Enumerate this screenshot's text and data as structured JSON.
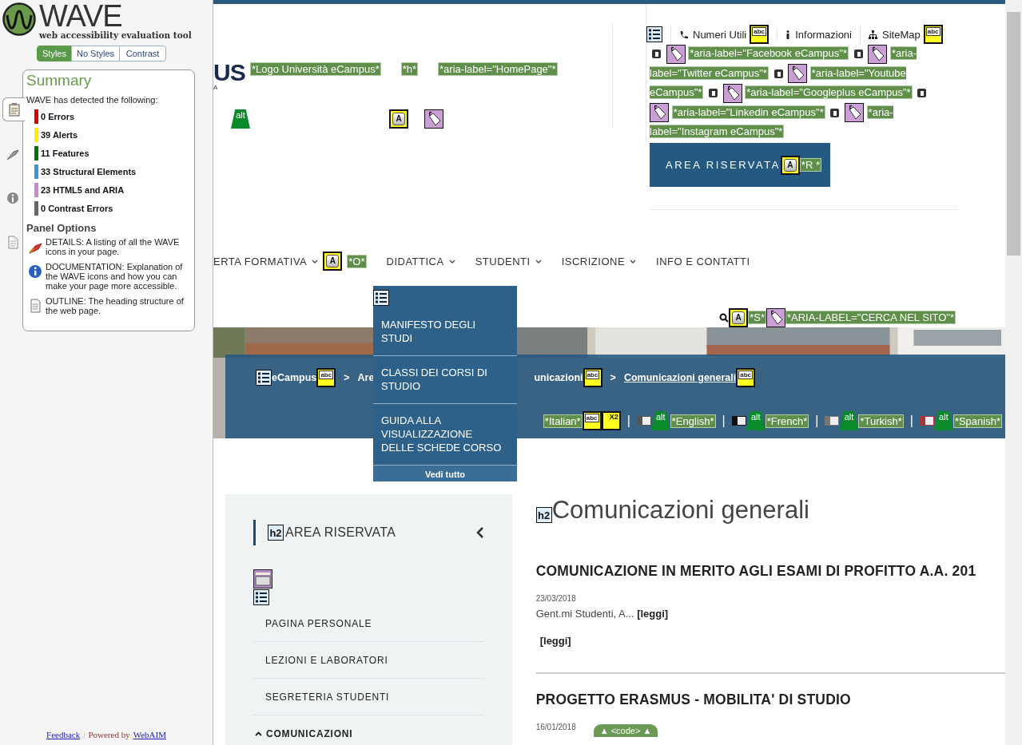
{
  "wave": {
    "logo_title": "WAVE",
    "logo_subtitle": "web accessibility evaluation tool",
    "view_tabs": [
      {
        "label": "Styles",
        "selected": true
      },
      {
        "label": "No Styles",
        "selected": false
      },
      {
        "label": "Contrast",
        "selected": false
      }
    ],
    "side_tabs": [
      {
        "kind": "summary",
        "selected": true
      },
      {
        "kind": "details",
        "selected": false
      },
      {
        "kind": "documentation",
        "selected": false
      },
      {
        "kind": "outline",
        "selected": false
      }
    ],
    "summary": {
      "title": "Summary",
      "intro": "WAVE has detected the following:",
      "items": [
        {
          "label": "0 Errors",
          "color": "#e00000"
        },
        {
          "label": "39 Alerts",
          "color": "#ffee00"
        },
        {
          "label": "11 Features",
          "color": "#007700"
        },
        {
          "label": "33 Structural Elements",
          "color": "#3399dd"
        },
        {
          "label": "23 HTML5 and ARIA",
          "color": "#cc88cc"
        },
        {
          "label": "0 Contrast Errors",
          "color": "#666666"
        }
      ],
      "options_title": "Panel Options",
      "options": [
        {
          "kind": "details",
          "text": "DETAILS: A listing of all the WAVE icons in your page."
        },
        {
          "kind": "documentation",
          "text": "DOCUMENTATION: Explanation of the WAVE icons and how you can make your page more accessible."
        },
        {
          "kind": "outline",
          "text": "OUTLINE: The heading structure of the web page."
        }
      ]
    },
    "footer": {
      "feedback": "Feedback",
      "separator": "|",
      "powered_by": "Powered by",
      "webaim": "WebAIM"
    }
  },
  "page": {
    "logo": {
      "text": "US",
      "tagline": "A"
    },
    "logo_labels": [
      {
        "kind": "label",
        "text": "*Logo Università eCampus*"
      },
      {
        "kind": "label",
        "text": "*h*"
      },
      {
        "kind": "label",
        "text": "*aria-label=\"HomePage\"*"
      }
    ],
    "logo_icons": [
      {
        "kind": "alt",
        "label": "alt"
      },
      {
        "kind": "accesskey",
        "label": "A"
      },
      {
        "kind": "tag"
      }
    ],
    "utility": [
      [
        {
          "kind": "list"
        }
      ],
      [
        {
          "kind": "phone"
        },
        {
          "kind": "text",
          "text": "Numeri Utili"
        },
        {
          "kind": "abc",
          "label": "abc"
        }
      ],
      [
        {
          "kind": "info"
        },
        {
          "kind": "text",
          "text": "Informazioni"
        }
      ],
      [
        {
          "kind": "sitemap"
        },
        {
          "kind": "text",
          "text": "SiteMap"
        },
        {
          "kind": "abc",
          "label": "abc"
        }
      ]
    ],
    "social": [
      {
        "kind": "social"
      },
      {
        "kind": "tag"
      },
      {
        "kind": "label",
        "text": "*aria-label=\"Facebook eCampus\"*"
      },
      {
        "kind": "social"
      },
      {
        "kind": "tag"
      },
      {
        "kind": "label",
        "text": "*aria-label=\"Twitter eCampus\"*"
      },
      {
        "kind": "social"
      },
      {
        "kind": "tag"
      },
      {
        "kind": "label",
        "text": "*aria-label=\"Youtube eCampus\"*"
      },
      {
        "kind": "social"
      },
      {
        "kind": "tag"
      },
      {
        "kind": "label",
        "text": "*aria-label=\"Googleplus eCampus\"*"
      },
      {
        "kind": "social"
      },
      {
        "kind": "tag"
      },
      {
        "kind": "label",
        "text": "*aria-label=\"Linkedin eCampus\"*"
      },
      {
        "kind": "social"
      },
      {
        "kind": "tag"
      },
      {
        "kind": "label",
        "text": "*aria-label=\"Instagram eCampus\"*"
      }
    ],
    "reserved_button": {
      "label": "AREA RISERVATA",
      "marks": [
        {
          "kind": "accesskey",
          "label": "A"
        },
        {
          "kind": "label",
          "text": "*R *"
        }
      ]
    },
    "nav": [
      {
        "label": "ERTA FORMATIVA",
        "dropdown": true,
        "marks": [
          {
            "kind": "accesskey",
            "label": "A"
          },
          {
            "kind": "label",
            "text": "*O*"
          }
        ]
      },
      {
        "label": "DIDATTICA",
        "dropdown": true
      },
      {
        "label": "STUDENTI",
        "dropdown": true
      },
      {
        "label": "ISCRIZIONE",
        "dropdown": true
      },
      {
        "label": "INFO E CONTATTI",
        "dropdown": false
      }
    ],
    "search": [
      {
        "kind": "search"
      },
      {
        "kind": "accesskey",
        "label": "A"
      },
      {
        "kind": "label",
        "text": "*S*"
      },
      {
        "kind": "tag"
      },
      {
        "kind": "label",
        "text": "*ARIA-LABEL=\"CERCA NEL SITO\"*"
      }
    ],
    "dropdown_menu": {
      "items": [
        "MANIFESTO DEGLI STUDI",
        "CLASSI DEI CORSI DI STUDIO",
        "GUIDA ALLA VISUALIZZAZIONE DELLE SCHEDE CORSO"
      ],
      "footer": "Vedi tutto"
    },
    "breadcrumb_start": [
      {
        "kind": "list"
      },
      {
        "kind": "text",
        "text": "eCampus"
      },
      {
        "kind": "abc",
        "label": "abc"
      },
      {
        "kind": "crumbsep",
        "text": ">"
      },
      {
        "kind": "text",
        "text": "Are"
      }
    ],
    "breadcrumb_end": [
      {
        "kind": "text",
        "text": "unicazioni"
      },
      {
        "kind": "abc",
        "label": "abc"
      },
      {
        "kind": "crumbsep",
        "text": ">"
      },
      {
        "kind": "link",
        "text": "Comunicazioni generali"
      },
      {
        "kind": "abc",
        "label": "abc"
      }
    ],
    "languages": [
      {
        "kind": "label",
        "text": "*Italian*"
      },
      {
        "kind": "abc",
        "label": "abc"
      },
      {
        "kind": "x2",
        "label": "X2"
      },
      {
        "kind": "crumbsep",
        "text": "|"
      },
      {
        "kind": "flag",
        "color": "#555555"
      },
      {
        "kind": "alt",
        "label": "alt"
      },
      {
        "kind": "label",
        "text": "*English*"
      },
      {
        "kind": "crumbsep",
        "text": "|"
      },
      {
        "kind": "flag",
        "color": "#111111"
      },
      {
        "kind": "alt",
        "label": "alt"
      },
      {
        "kind": "label",
        "text": "*French*"
      },
      {
        "kind": "crumbsep",
        "text": "|"
      },
      {
        "kind": "flag",
        "color": "#777777"
      },
      {
        "kind": "alt",
        "label": "alt"
      },
      {
        "kind": "label",
        "text": "*Turkish*"
      },
      {
        "kind": "crumbsep",
        "text": "|"
      },
      {
        "kind": "flag",
        "color": "#aa3333"
      },
      {
        "kind": "alt",
        "label": "alt"
      },
      {
        "kind": "label",
        "text": "*Spanish*"
      }
    ],
    "sidebar": {
      "heading": {
        "icon": {
          "kind": "h2",
          "label": "h2"
        },
        "text": "AREA RISERVATA"
      },
      "icons": [
        {
          "kind": "form"
        },
        {
          "kind": "list"
        }
      ],
      "items": [
        {
          "label": "PAGINA PERSONALE",
          "expanded": false
        },
        {
          "label": "LEZIONI E LABORATORI",
          "expanded": false
        },
        {
          "label": "SEGRETERIA STUDENTI",
          "expanded": false
        },
        {
          "label": "COMUNICAZIONI",
          "expanded": true
        }
      ]
    },
    "main": {
      "heading": {
        "icon": {
          "kind": "h2",
          "label": "h2"
        },
        "text": "Comunicazioni generali"
      },
      "articles": [
        {
          "title": "COMUNICAZIONE IN MERITO AGLI ESAMI DI PROFITTO A.A. 201",
          "date": "23/03/2018",
          "excerpt": "Gent.mi Studenti, A...  **[leggi]**",
          "more": "[leggi]"
        },
        {
          "title": "PROGETTO ERASMUS - MOBILITA' DI STUDIO",
          "date": "16/01/2018",
          "marks": [
            {
              "kind": "code",
              "label": "▲ <code> ▲"
            }
          ]
        }
      ]
    }
  }
}
